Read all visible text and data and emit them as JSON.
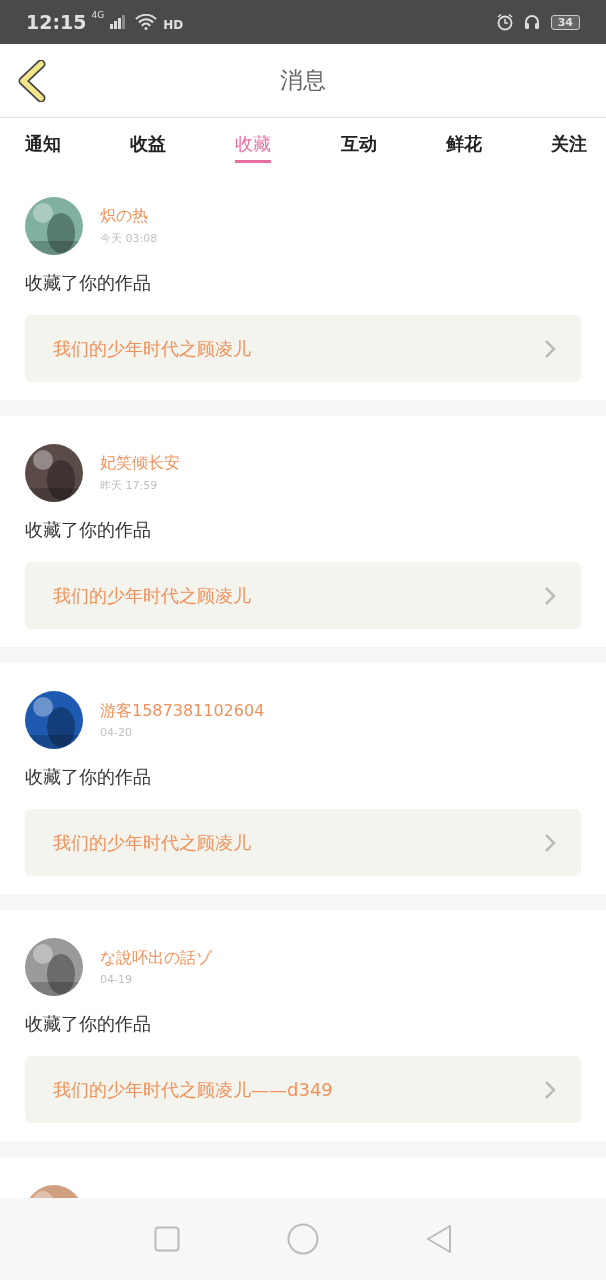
{
  "status_bar": {
    "time": "12:15",
    "network": "4G",
    "wifi_label": "HD",
    "battery": "34"
  },
  "header": {
    "title": "消息"
  },
  "tabs": [
    {
      "label": "通知",
      "selected": false
    },
    {
      "label": "收益",
      "selected": false
    },
    {
      "label": "收藏",
      "selected": true
    },
    {
      "label": "互动",
      "selected": false
    },
    {
      "label": "鲜花",
      "selected": false
    },
    {
      "label": "关注",
      "selected": false
    }
  ],
  "messages": [
    {
      "name": "炽の热",
      "time": "今天 03:08",
      "text": "收藏了你的作品",
      "work": "我们的少年时代之顾凌儿",
      "avatar": {
        "kind": "picture"
      }
    },
    {
      "name": "妃笑倾长安",
      "time": "昨天 17:59",
      "text": "收藏了你的作品",
      "work": "我们的少年时代之顾凌儿",
      "avatar": {
        "kind": "picture"
      }
    },
    {
      "name": "游客1587381102604",
      "time": "04-20",
      "text": "收藏了你的作品",
      "work": "我们的少年时代之顾凌儿",
      "avatar": {
        "kind": "picture"
      }
    },
    {
      "name": "な說吥出の話ゾ",
      "time": "04-19",
      "text": "收藏了你的作品",
      "work": "我们的少年时代之顾凌儿——d349",
      "avatar": {
        "kind": "picture"
      }
    },
    {
      "avatar": {
        "kind": "picture"
      }
    }
  ]
}
